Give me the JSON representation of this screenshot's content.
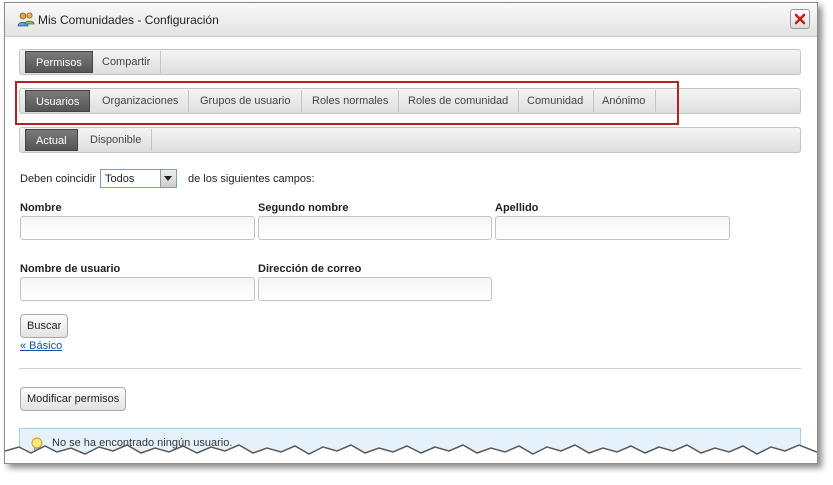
{
  "window": {
    "title": "Mis Comunidades - Configuración",
    "close_icon": "close-icon"
  },
  "tabs_main": [
    "Permisos",
    "Compartir"
  ],
  "tabs_roles": [
    "Usuarios",
    "Organizaciones",
    "Grupos de usuario",
    "Roles normales",
    "Roles de comunidad",
    "Comunidad",
    "Anónimo"
  ],
  "tabs_status": [
    "Actual",
    "Disponible"
  ],
  "match": {
    "prefix": "Deben coincidir",
    "selected": "Todos",
    "suffix": "de los siguientes campos:"
  },
  "fields": {
    "first_name": {
      "label": "Nombre",
      "value": ""
    },
    "middle_name": {
      "label": "Segundo nombre",
      "value": ""
    },
    "last_name": {
      "label": "Apellido",
      "value": ""
    },
    "screen_name": {
      "label": "Nombre de usuario",
      "value": ""
    },
    "email": {
      "label": "Dirección de correo",
      "value": ""
    }
  },
  "search_button": "Buscar",
  "basic_link": "« Básico",
  "modify_button": "Modificar permisos",
  "info_message": "No se ha encontrado ningún usuario.",
  "colors": {
    "active_tab": "#5e5e5e",
    "highlight": "#b22222",
    "info_bg": "#e6f2fb",
    "link": "#1a4fa0"
  }
}
